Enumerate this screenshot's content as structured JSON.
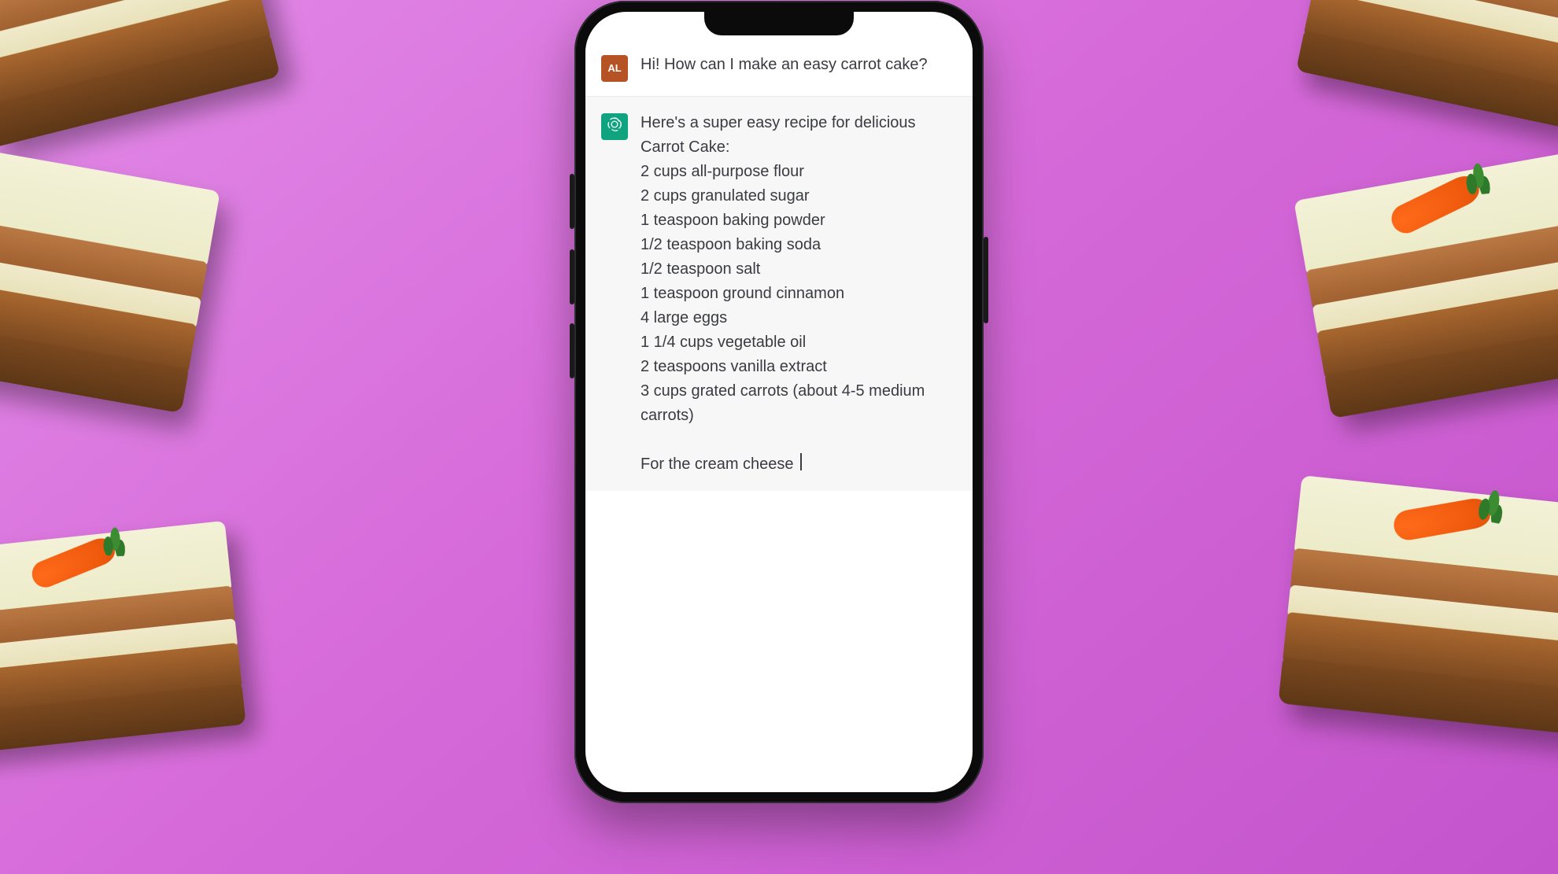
{
  "user": {
    "avatar_initials": "AL",
    "message": "Hi! How can I make an easy carrot cake?"
  },
  "assistant": {
    "intro": "Here's a super easy recipe for delicious Carrot Cake:",
    "ingredients": [
      "2 cups all-purpose flour",
      "2 cups granulated sugar",
      "1 teaspoon baking powder",
      "1/2 teaspoon baking soda",
      "1/2 teaspoon salt",
      "1 teaspoon ground cinnamon",
      "4 large eggs",
      "1 1/4 cups vegetable oil",
      "2 teaspoons vanilla extract",
      "3 cups grated carrots (about 4-5 medium carrots)"
    ],
    "continuation": "For the cream cheese "
  },
  "colors": {
    "user_avatar_bg": "#b55325",
    "assistant_avatar_bg": "#10a37f",
    "assistant_bg": "#f7f7f8",
    "background_pink": "#d66ad9"
  }
}
